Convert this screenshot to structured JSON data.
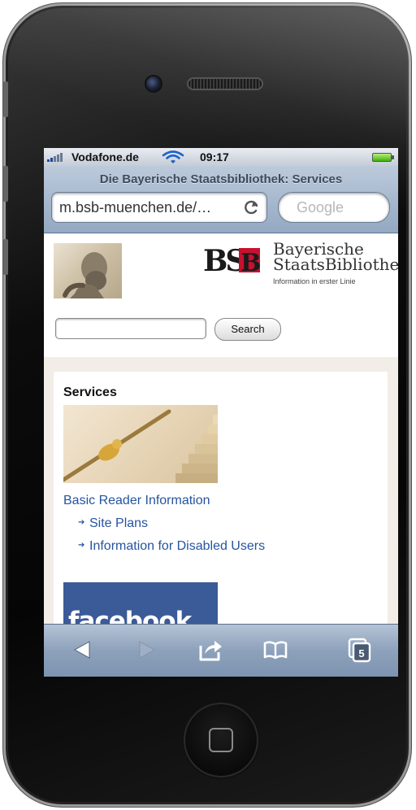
{
  "status_bar": {
    "carrier": "Vodafone.de",
    "time": "09:17"
  },
  "browser": {
    "page_title": "Die Bayerische Staatsbibliothek: Services",
    "url": "m.bsb-muenchen.de/…",
    "search_placeholder": "Google",
    "tab_count": "5"
  },
  "site": {
    "logo_mark": "BSB",
    "logo_line1": "Bayerische",
    "logo_line2": "StaatsBibliothek",
    "slogan": "Information in erster Linie",
    "search_button": "Search",
    "services_heading": "Services",
    "basic_reader_link": "Basic Reader Information",
    "sub_links": [
      "Site Plans",
      "Information for Disabled Users"
    ],
    "facebook_label": "facebook"
  },
  "colors": {
    "link": "#2554a0",
    "toolbar": "#8da1bb",
    "logo_red": "#c8102e",
    "facebook_blue": "#3b5a98"
  },
  "icons": {
    "toolbar": [
      "back-icon",
      "forward-icon",
      "share-icon",
      "bookmarks-icon",
      "tabs-icon"
    ],
    "address": [
      "reload-icon"
    ],
    "status": [
      "signal-icon",
      "wifi-icon",
      "battery-icon"
    ]
  }
}
